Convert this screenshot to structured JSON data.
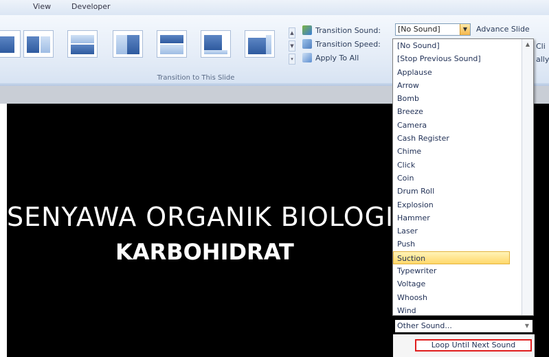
{
  "tabs": [
    "View",
    "Developer"
  ],
  "ribbon": {
    "group_label": "Transition to This Slide",
    "transition_sound_label": "Transition Sound:",
    "transition_sound_value": "[No Sound]",
    "transition_speed_label": "Transition Speed:",
    "apply_to_all_label": "Apply To All",
    "advance_slide_label": "Advance Slide",
    "cut_right_1": "Cli",
    "cut_right_2": "ally"
  },
  "slide": {
    "title": "SENYAWA ORGANIK BIOLOGI",
    "subtitle": "KARBOHIDRAT",
    "background_color": "#000000"
  },
  "sound_dropdown": {
    "selected": "Suction",
    "items": [
      "[No Sound]",
      "[Stop Previous Sound]",
      "Applause",
      "Arrow",
      "Bomb",
      "Breeze",
      "Camera",
      "Cash Register",
      "Chime",
      "Click",
      "Coin",
      "Drum Roll",
      "Explosion",
      "Hammer",
      "Laser",
      "Push",
      "Suction",
      "Typewriter",
      "Voltage",
      "Whoosh",
      "Wind"
    ],
    "other_sound_label": "Other Sound...",
    "loop_label": "Loop Until Next Sound"
  },
  "colors": {
    "highlight": "#ffd86b",
    "loop_outline": "#e01d1d"
  }
}
